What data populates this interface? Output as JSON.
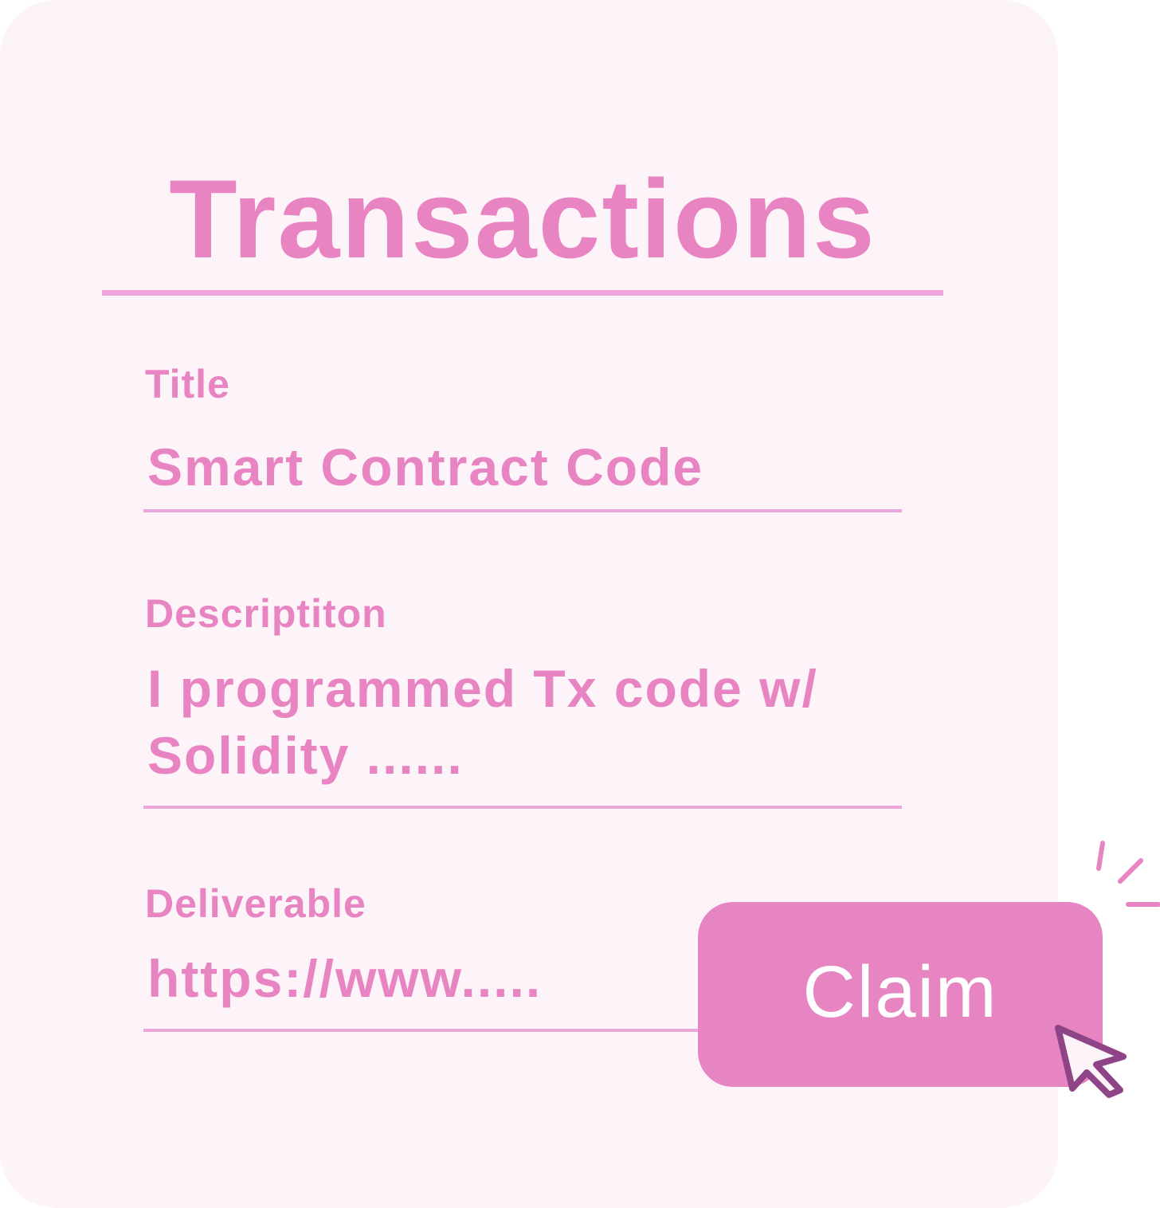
{
  "card": {
    "title": "Transactions"
  },
  "fields": {
    "title": {
      "label": "Title",
      "value": "Smart Contract Code"
    },
    "description": {
      "label": "Descriptiton",
      "value_line1": "I programmed Tx code w/",
      "value_line2": "Solidity ......"
    },
    "deliverable": {
      "label": "Deliverable",
      "value": "https://www....."
    }
  },
  "actions": {
    "claim_label": "Claim"
  },
  "colors": {
    "accent": "#e884c2",
    "card_background": "#fdf4f9",
    "cursor": "#8e4487"
  },
  "icons": {
    "pointer": "cursor-arrow-icon",
    "click_burst": "sparkle-icon"
  }
}
